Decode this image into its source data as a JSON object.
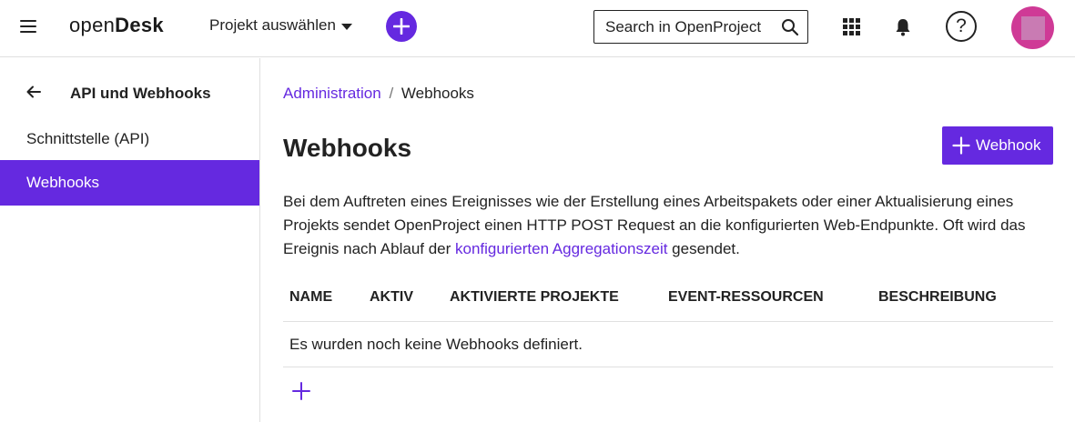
{
  "header": {
    "logo_light": "open",
    "logo_bold": "Desk",
    "project_select": "Projekt auswählen",
    "search_placeholder": "Search in OpenProject",
    "icons": [
      "hamburger-icon",
      "caret-down-icon",
      "plus-icon",
      "search-icon",
      "app-grid-icon",
      "bell-icon",
      "help-icon"
    ],
    "accent_color": "#6529e0",
    "avatar_color": "#cf3a96"
  },
  "sidebar": {
    "title": "API und Webhooks",
    "items": [
      {
        "label": "Schnittstelle (API)",
        "active": false
      },
      {
        "label": "Webhooks",
        "active": true
      }
    ]
  },
  "main": {
    "breadcrumb": {
      "parent": "Administration",
      "separator": "/",
      "current": "Webhooks"
    },
    "title": "Webhooks",
    "add_button_label": "Webhook",
    "description": {
      "before_link": "Bei dem Auftreten eines Ereignisses wie der Erstellung eines Arbeitspakets oder einer Aktualisierung eines Projekts sendet OpenProject einen HTTP POST Request an die konfigurierten Web-Endpunkte. Oft wird das Ereignis nach Ablauf der ",
      "link": "konfigurierten Aggregationszeit",
      "after_link": " gesendet."
    },
    "table": {
      "columns": [
        "NAME",
        "AKTIV",
        "AKTIVIERTE PROJEKTE",
        "EVENT-RESSOURCEN",
        "BESCHREIBUNG"
      ],
      "empty_message": "Es wurden noch keine Webhooks definiert."
    }
  }
}
